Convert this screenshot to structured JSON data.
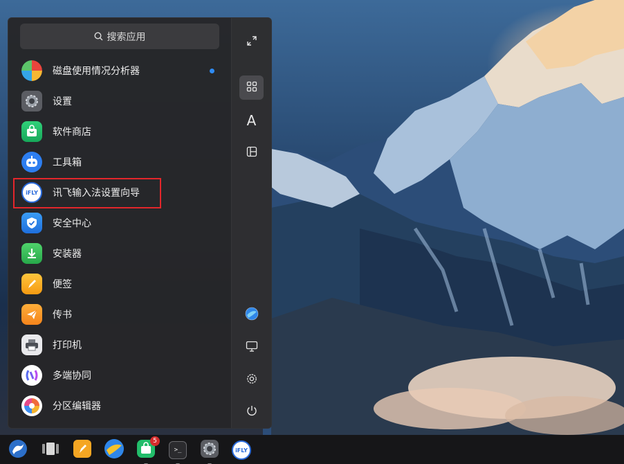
{
  "launcher": {
    "search_placeholder": "搜索应用",
    "apps": [
      {
        "label": "磁盘使用情况分析器",
        "icon": "disk-usage-analyzer-icon",
        "new": true
      },
      {
        "label": "设置",
        "icon": "settings-icon"
      },
      {
        "label": "软件商店",
        "icon": "software-store-icon"
      },
      {
        "label": "工具箱",
        "icon": "toolbox-icon"
      },
      {
        "label": "讯飞输入法设置向导",
        "icon": "ifly-icon",
        "highlighted": true
      },
      {
        "label": "安全中心",
        "icon": "security-center-icon"
      },
      {
        "label": "安装器",
        "icon": "installer-icon"
      },
      {
        "label": "便签",
        "icon": "notes-icon"
      },
      {
        "label": "传书",
        "icon": "transfer-icon"
      },
      {
        "label": "打印机",
        "icon": "printer-icon"
      },
      {
        "label": "多端协同",
        "icon": "multi-device-icon"
      },
      {
        "label": "分区编辑器",
        "icon": "partition-editor-icon"
      }
    ],
    "ifly_icon_text": "iFLY",
    "side_letter_view": "A",
    "side_buttons": [
      "expand-icon",
      "grid-view-icon",
      "letter-sort-icon",
      "category-view-icon",
      "browser-icon",
      "display-icon",
      "gear-icon",
      "power-icon"
    ]
  },
  "taskbar": {
    "items": [
      "start-menu-icon",
      "multitask-view-icon",
      "notes-app-icon",
      "browser-app-icon",
      "software-store-app-icon",
      "terminal-app-icon",
      "settings-app-icon",
      "ifly-app-icon"
    ],
    "store_badge": "5",
    "terminal_glyph": ">_",
    "ifly_text": "iFLY"
  },
  "colors": {
    "highlight": "#e3262b",
    "new_dot": "#2f8cf5",
    "badge": "#d62c2c"
  }
}
